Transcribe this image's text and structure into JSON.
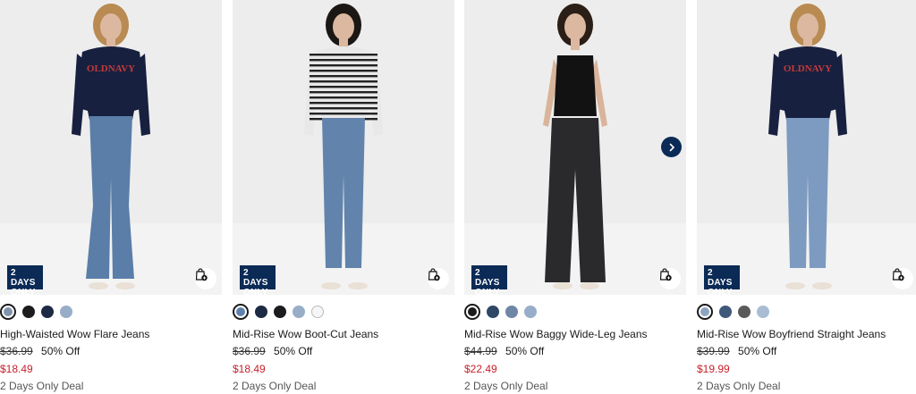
{
  "products": [
    {
      "badge_line1": "2 DAYS",
      "badge_line2": "ONLY",
      "name": "High-Waisted Wow Flare Jeans",
      "original_price": "$36.99",
      "discount": "50% Off",
      "sale_price": "$18.49",
      "deal": "2 Days Only Deal",
      "swatches": [
        "#7f93ad",
        "#1c1c1f",
        "#1c2a44",
        "#98aec8"
      ],
      "top_color": "#17203f",
      "jeans_color": "#5a7ea8",
      "hair_color": "#b98a52"
    },
    {
      "badge_line1": "2 DAYS",
      "badge_line2": "ONLY",
      "name": "Mid-Rise Wow Boot-Cut Jeans",
      "original_price": "$36.99",
      "discount": "50% Off",
      "sale_price": "$18.49",
      "deal": "2 Days Only Deal",
      "swatches": [
        "#5f82ad",
        "#1c2a44",
        "#1c1c1f",
        "#98aec8",
        "#f6f6f6"
      ],
      "top_color": "#e8e8e8",
      "jeans_color": "#6284ac",
      "hair_color": "#1b1714"
    },
    {
      "badge_line1": "2 DAYS",
      "badge_line2": "ONLY",
      "name": "Mid-Rise Wow Baggy Wide-Leg Jeans",
      "original_price": "$44.99",
      "discount": "50% Off",
      "sale_price": "$22.49",
      "deal": "2 Days Only Deal",
      "swatches": [
        "#1c1c1f",
        "#2f4866",
        "#6f86a6",
        "#98aec8"
      ],
      "top_color": "#121212",
      "jeans_color": "#2a2a2c",
      "hair_color": "#2a1e16"
    },
    {
      "badge_line1": "2 DAYS",
      "badge_line2": "ONLY",
      "name": "Mid-Rise Wow Boyfriend Straight Jeans",
      "original_price": "$39.99",
      "discount": "50% Off",
      "sale_price": "$19.99",
      "deal": "2 Days Only Deal",
      "swatches": [
        "#8ca4c2",
        "#40587a",
        "#5a5a5c",
        "#a8bcd4"
      ],
      "top_color": "#17203f",
      "jeans_color": "#7d9bc0",
      "hair_color": "#b98a52"
    }
  ],
  "icons": {
    "bag": "add-to-bag-icon",
    "next": "chevron-right-icon"
  },
  "colors": {
    "brand_navy": "#0b2a56",
    "sale_red": "#c8202b"
  }
}
